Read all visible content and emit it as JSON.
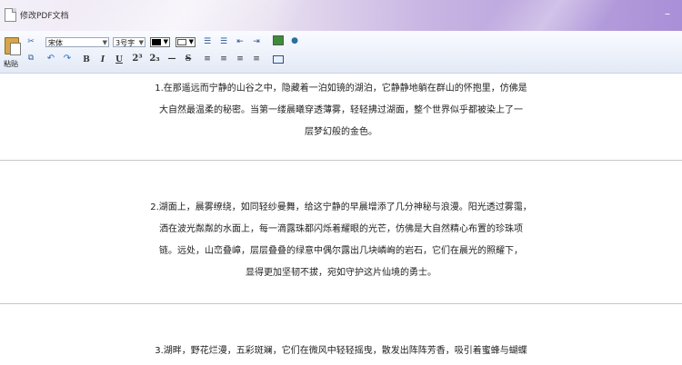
{
  "window": {
    "title": "修改PDF文档",
    "minimize": "–"
  },
  "toolbar": {
    "paste_label": "粘贴",
    "font_name": "宋体",
    "font_size": "3号字",
    "superscript": "2³",
    "subscript": "2₃",
    "bold": "B",
    "italic": "I",
    "underline": "U",
    "strike": "S",
    "hr": "—",
    "font_color": "#000000",
    "highlight_color": "#ffffff"
  },
  "document": {
    "paragraphs": [
      {
        "lines": [
          "1.在那遥远而宁静的山谷之中，隐藏着一泊如镜的湖泊，它静静地躺在群山的怀抱里，仿佛是",
          "大自然最温柔的秘密。当第一缕晨曦穿透薄雾，轻轻拂过湖面，整个世界似乎都被染上了一",
          "层梦幻般的金色。"
        ]
      },
      {
        "lines": [
          "2.湖面上，晨雾缭绕，如同轻纱曼舞，给这宁静的早晨增添了几分神秘与浪漫。阳光透过雾霭，",
          "洒在波光粼粼的水面上，每一滴露珠都闪烁着耀眼的光芒，仿佛是大自然精心布置的珍珠项",
          "链。远处，山峦叠嶂，层层叠叠的绿意中偶尔露出几块嶙峋的岩石，它们在晨光的照耀下，",
          "显得更加坚韧不拔，宛如守护这片仙境的勇士。"
        ]
      },
      {
        "lines": [
          "3.湖畔，野花烂漫，五彩斑斓，它们在微风中轻轻摇曳，散发出阵阵芳香，吸引着蜜蜂与蝴蝶"
        ]
      }
    ]
  }
}
